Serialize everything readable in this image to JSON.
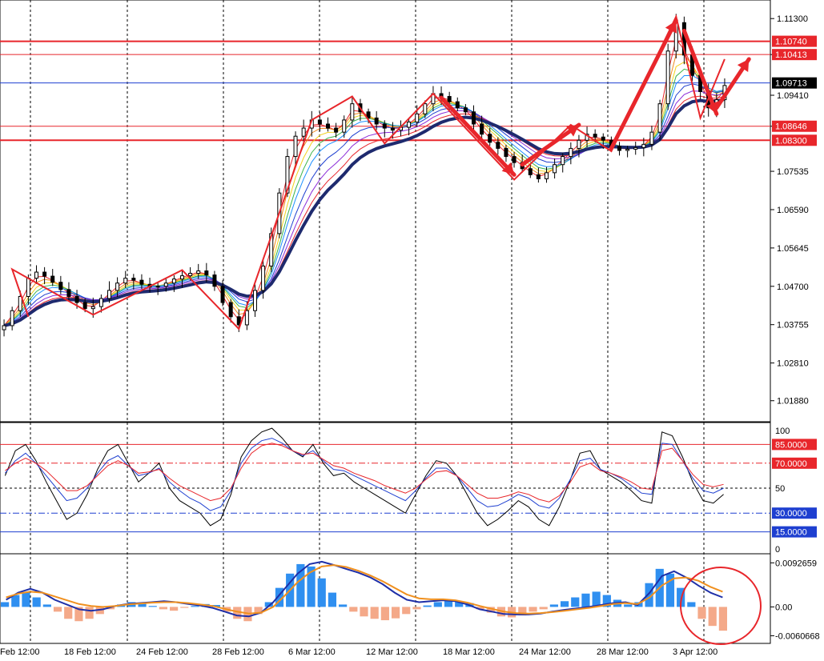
{
  "chart_data": [
    {
      "panel": "price",
      "type": "candlestick",
      "price_ticks": [
        "1.11300",
        "1.10413",
        "1.09410",
        "1.08646",
        "1.07535",
        "1.06590",
        "1.05645",
        "1.04700",
        "1.03755",
        "1.02810",
        "1.01880"
      ],
      "ylim": [
        1.015,
        1.116
      ],
      "marked_levels": [
        {
          "value": 1.1074,
          "label": "1.10740",
          "color": "#e8262b",
          "weight": "thick"
        },
        {
          "value": 1.10413,
          "label": "1.10413",
          "color": "#e8262b",
          "weight": "thin"
        },
        {
          "value": 1.08646,
          "label": "1.08646",
          "color": "#e8262b",
          "weight": "thin"
        },
        {
          "value": 1.083,
          "label": "1.08300",
          "color": "#e8262b",
          "weight": "thick"
        }
      ],
      "current_price": {
        "value": 1.09713,
        "label": "1.09713",
        "color": "#1e3fd0"
      },
      "close_series": [
        1.0373,
        1.041,
        1.0445,
        1.049,
        1.0505,
        1.0495,
        1.048,
        1.0462,
        1.0445,
        1.043,
        1.0415,
        1.042,
        1.044,
        1.046,
        1.0478,
        1.049,
        1.0485,
        1.0475,
        1.0468,
        1.047,
        1.0478,
        1.0488,
        1.0496,
        1.0502,
        1.0508,
        1.0498,
        1.047,
        1.043,
        1.0395,
        1.0375,
        1.041,
        1.046,
        1.052,
        1.06,
        1.07,
        1.079,
        1.084,
        1.086,
        1.088,
        1.087,
        1.086,
        1.085,
        1.088,
        1.092,
        1.09,
        1.0885,
        1.087,
        1.086,
        1.0855,
        1.0862,
        1.0875,
        1.0895,
        1.092,
        1.0945,
        1.0938,
        1.0925,
        1.091,
        1.09,
        1.087,
        1.0845,
        1.0825,
        1.081,
        1.079,
        1.0775,
        1.076,
        1.0745,
        1.0735,
        1.075,
        1.077,
        1.079,
        1.081,
        1.083,
        1.0845,
        1.0838,
        1.083,
        1.0815,
        1.0805,
        1.0808,
        1.0812,
        1.082,
        1.085,
        1.092,
        1.105,
        1.112,
        1.104,
        1.099,
        1.095,
        1.091,
        1.093,
        1.0965
      ],
      "dates": [
        "Feb 12:00",
        "18 Feb 12:00",
        "24 Feb 12:00",
        "28 Feb 12:00",
        "6 Mar 12:00",
        "12 Mar 12:00",
        "18 Mar 12:00",
        "24 Mar 12:00",
        "28 Mar 12:00",
        "3 Apr 12:00"
      ]
    },
    {
      "panel": "oscillator",
      "type": "line",
      "ylim": [
        0,
        100
      ],
      "ticks": [
        "100",
        "50",
        "0"
      ],
      "levels": [
        {
          "value": 85,
          "label": "85.0000",
          "color": "#e8262b",
          "style": "solid"
        },
        {
          "value": 70,
          "label": "70.0000",
          "color": "#e8262b",
          "style": "dashdot"
        },
        {
          "value": 30,
          "label": "30.0000",
          "color": "#1e3fd0",
          "style": "dashdot"
        },
        {
          "value": 15,
          "label": "15.0000",
          "color": "#1e3fd0",
          "style": "solid"
        }
      ],
      "series": [
        {
          "color": "#000000",
          "values": [
            60,
            80,
            85,
            72,
            55,
            40,
            25,
            30,
            45,
            65,
            80,
            85,
            70,
            55,
            62,
            70,
            50,
            40,
            35,
            30,
            20,
            25,
            45,
            75,
            88,
            95,
            98,
            90,
            80,
            75,
            85,
            70,
            60,
            62,
            55,
            50,
            45,
            40,
            35,
            30,
            45,
            60,
            72,
            70,
            60,
            45,
            30,
            20,
            25,
            32,
            40,
            35,
            25,
            20,
            35,
            55,
            78,
            80,
            65,
            60,
            55,
            48,
            40,
            38,
            95,
            92,
            75,
            55,
            40,
            38,
            45
          ]
        },
        {
          "color": "#1e3fd0",
          "values": [
            62,
            72,
            78,
            70,
            60,
            50,
            40,
            42,
            50,
            62,
            72,
            76,
            68,
            60,
            62,
            66,
            55,
            48,
            42,
            38,
            32,
            35,
            48,
            70,
            82,
            88,
            90,
            86,
            80,
            76,
            80,
            72,
            65,
            64,
            60,
            56,
            52,
            48,
            44,
            40,
            48,
            58,
            66,
            66,
            60,
            50,
            40,
            35,
            36,
            40,
            45,
            42,
            36,
            34,
            42,
            56,
            72,
            74,
            65,
            62,
            58,
            52,
            46,
            45,
            86,
            85,
            72,
            58,
            48,
            46,
            50
          ]
        },
        {
          "color": "#e8262b",
          "values": [
            64,
            70,
            74,
            70,
            64,
            56,
            48,
            48,
            52,
            60,
            68,
            72,
            68,
            62,
            63,
            65,
            58,
            52,
            48,
            44,
            40,
            42,
            50,
            66,
            78,
            84,
            86,
            84,
            80,
            77,
            78,
            73,
            68,
            66,
            62,
            59,
            56,
            52,
            49,
            46,
            50,
            57,
            63,
            64,
            60,
            53,
            46,
            42,
            42,
            44,
            47,
            45,
            41,
            39,
            44,
            54,
            67,
            70,
            64,
            62,
            59,
            55,
            50,
            49,
            80,
            82,
            72,
            61,
            53,
            51,
            53
          ]
        }
      ]
    },
    {
      "panel": "macd",
      "type": "bar",
      "ylim": [
        -0.007,
        0.0105
      ],
      "ticks": [
        "0.0092659",
        "0.00",
        "-0.0060668"
      ],
      "histogram": [
        0.001,
        0.0025,
        0.003,
        0.002,
        0.0005,
        -0.001,
        -0.0025,
        -0.003,
        -0.0025,
        -0.0015,
        -0.0005,
        0.0005,
        0.001,
        0.0008,
        0.0002,
        -0.0005,
        -0.0008,
        -0.0002,
        0.0002,
        0.0006,
        0.0004,
        -0.001,
        -0.0025,
        -0.003,
        -0.0015,
        0.001,
        0.004,
        0.007,
        0.009,
        0.0085,
        0.006,
        0.003,
        0.0005,
        -0.001,
        -0.002,
        -0.0025,
        -0.0028,
        -0.0024,
        -0.0015,
        -0.0005,
        0.0003,
        0.001,
        0.0015,
        0.0012,
        0.0008,
        -0.0005,
        -0.0012,
        -0.002,
        -0.0022,
        -0.0018,
        -0.001,
        -0.0005,
        0.0005,
        0.0012,
        0.002,
        0.0028,
        0.0032,
        0.0025,
        0.0015,
        0.0005,
        0.001,
        0.005,
        0.008,
        0.007,
        0.004,
        0.001,
        -0.0025,
        -0.004,
        -0.005
      ],
      "series": [
        {
          "color": "#1e2fa8",
          "values": [
            0.0015,
            0.003,
            0.0038,
            0.003,
            0.0015,
            0.0005,
            -0.0005,
            -0.0008,
            -0.0005,
            0.0002,
            0.0006,
            0.0008,
            0.001,
            0.0012,
            0.001,
            0.0006,
            0.0003,
            -0.0002,
            -0.001,
            -0.0018,
            -0.002,
            -0.0012,
            0.001,
            0.004,
            0.007,
            0.009,
            0.0095,
            0.0088,
            0.008,
            0.0072,
            0.0062,
            0.0048,
            0.003,
            0.0015,
            0.001,
            0.0012,
            0.0014,
            0.0012,
            0.0005,
            -0.0005,
            -0.001,
            -0.0015,
            -0.0016,
            -0.0016,
            -0.0014,
            -0.001,
            -0.0006,
            -0.0003,
            0.0,
            0.0004,
            0.0008,
            0.001,
            0.0004,
            0.003,
            0.0065,
            0.0075,
            0.0062,
            0.0045,
            0.003,
            0.002
          ]
        },
        {
          "color": "#f0901e",
          "values": [
            0.002,
            0.0028,
            0.0032,
            0.003,
            0.0022,
            0.0014,
            0.0006,
            0.0002,
            0.0,
            0.0002,
            0.0005,
            0.0007,
            0.0009,
            0.001,
            0.001,
            0.0008,
            0.0005,
            0.0002,
            -0.0004,
            -0.001,
            -0.0014,
            -0.0012,
            0.0,
            0.0025,
            0.0052,
            0.0072,
            0.0085,
            0.0088,
            0.0084,
            0.0076,
            0.0066,
            0.0054,
            0.004,
            0.0026,
            0.0018,
            0.0016,
            0.0016,
            0.0014,
            0.0009,
            0.0002,
            -0.0004,
            -0.001,
            -0.0013,
            -0.0014,
            -0.0013,
            -0.0011,
            -0.0008,
            -0.0005,
            -0.0002,
            0.0002,
            0.0006,
            0.0008,
            0.0006,
            0.002,
            0.0045,
            0.006,
            0.0062,
            0.0055,
            0.0042,
            0.0032
          ]
        }
      ]
    }
  ],
  "theme": {
    "background": "#ffffff",
    "grid": "#000000",
    "up_color": "#000000",
    "down_color": "#000000",
    "ribbon_colors": [
      "#e8262b",
      "#f08a1e",
      "#f2d21e",
      "#3cb44b",
      "#1e90ff",
      "#1e3fd0",
      "#8b2bd8"
    ],
    "slow_ma_color": "#1e2a6e",
    "annotation_color": "#e8262b",
    "histogram_positive": "#2f8ff0",
    "histogram_negative": "#f4a989"
  }
}
